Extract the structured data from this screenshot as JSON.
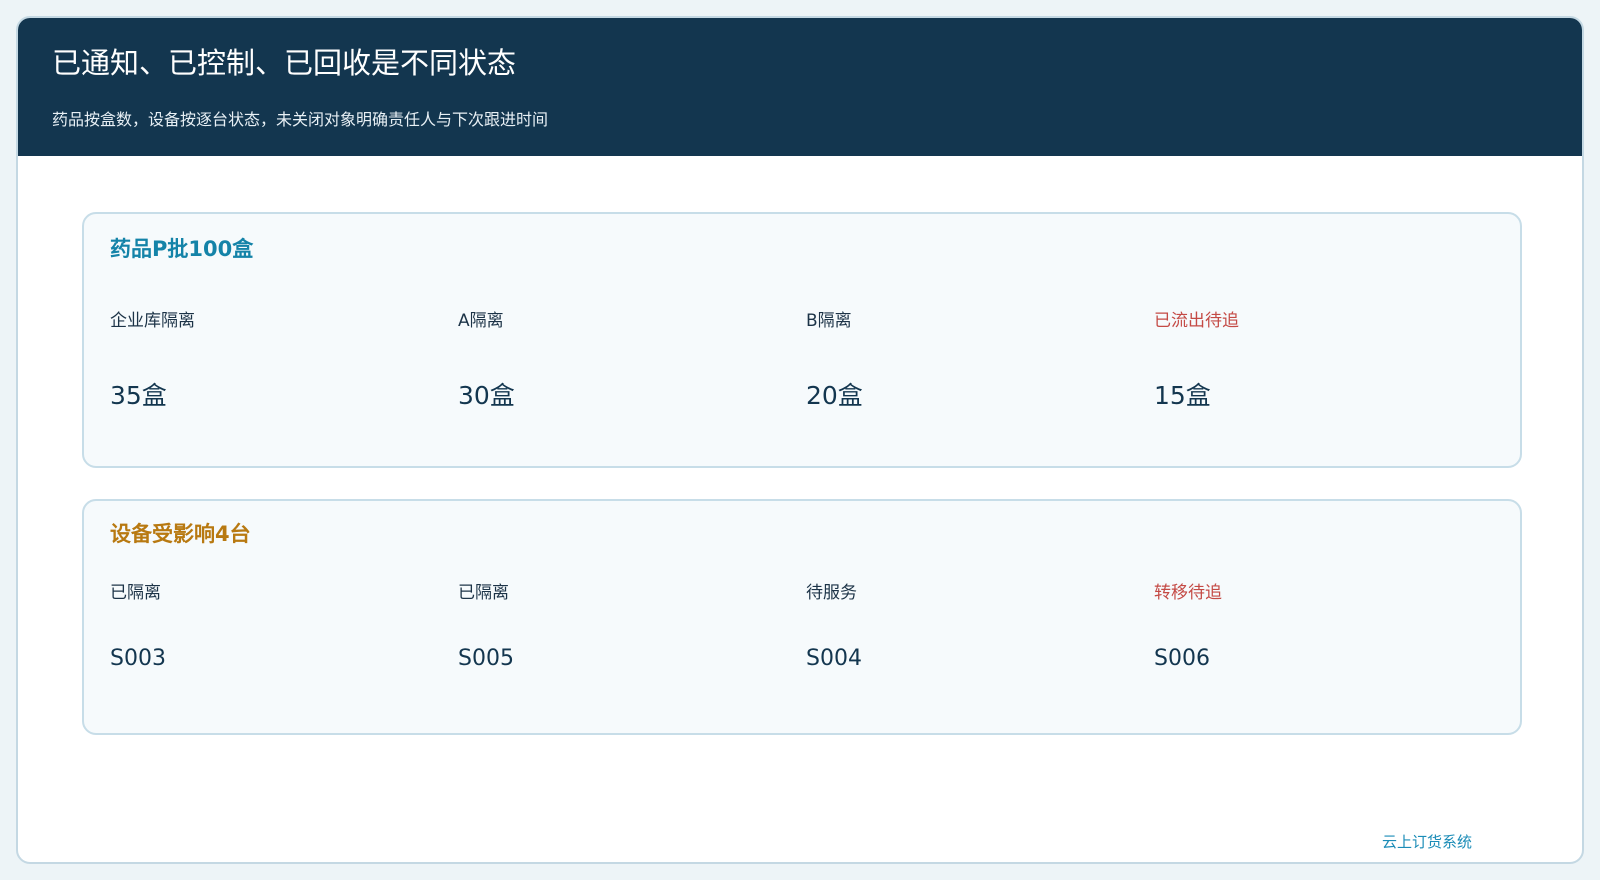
{
  "header": {
    "title": "已通知、已控制、已回收是不同状态",
    "subtitle": "药品按盒数，设备按逐台状态，未关闭对象明确责任人与下次跟进时间"
  },
  "drug_card": {
    "title": "药品P批100盒",
    "items": [
      {
        "label": "企业库隔离",
        "value": "35盒",
        "status": "normal"
      },
      {
        "label": "A隔离",
        "value": "30盒",
        "status": "normal"
      },
      {
        "label": "B隔离",
        "value": "20盒",
        "status": "normal"
      },
      {
        "label": "已流出待追",
        "value": "15盒",
        "status": "alert"
      }
    ]
  },
  "equipment_card": {
    "title": "设备受影响4台",
    "items": [
      {
        "label": "已隔离",
        "value": "S003",
        "status": "normal"
      },
      {
        "label": "已隔离",
        "value": "S005",
        "status": "normal"
      },
      {
        "label": "待服务",
        "value": "S004",
        "status": "normal"
      },
      {
        "label": "转移待追",
        "value": "S006",
        "status": "alert"
      }
    ]
  },
  "footer": {
    "brand": "云上订货系统"
  },
  "colors": {
    "header_background": "#13364f",
    "drug_title": "#1483a8",
    "equipment_title": "#b87911",
    "alert": "#c44a45",
    "footer_brand": "#1b8cb7"
  }
}
